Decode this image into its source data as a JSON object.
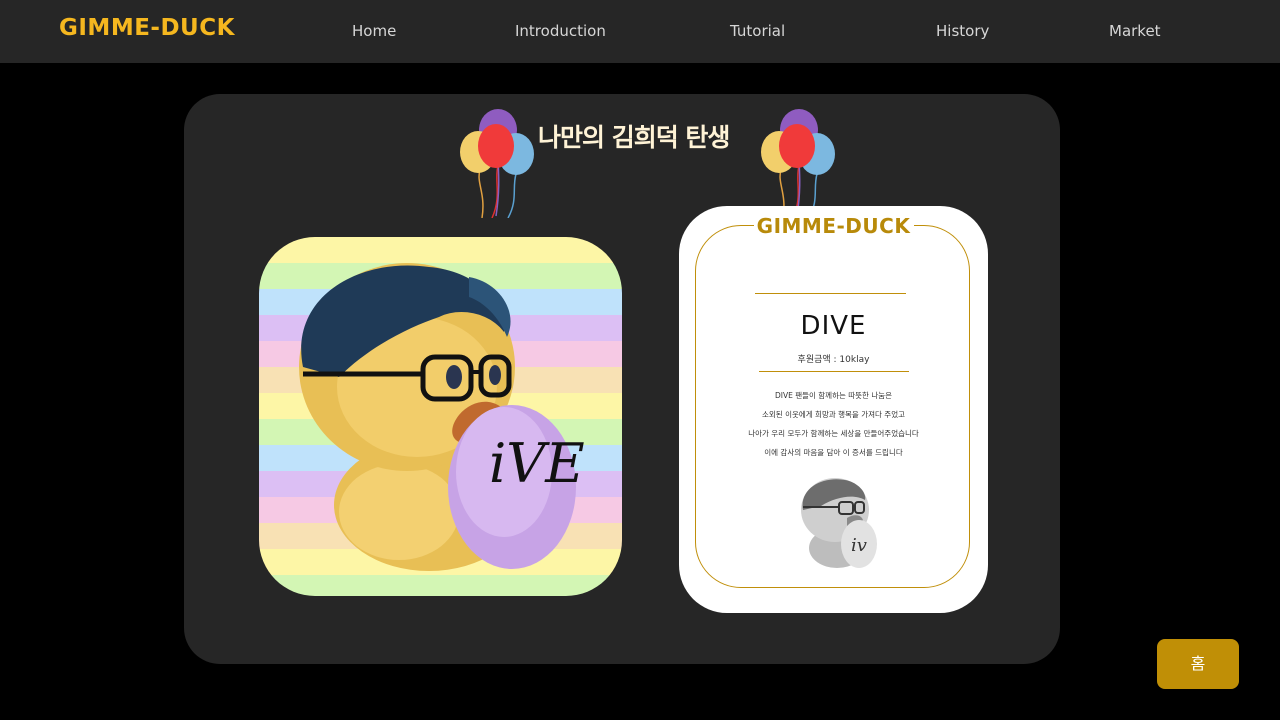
{
  "brand": "GIMME-DUCK",
  "nav": {
    "items": [
      {
        "label": "Home"
      },
      {
        "label": "Introduction"
      },
      {
        "label": "Tutorial"
      },
      {
        "label": "History"
      },
      {
        "label": "Market"
      }
    ]
  },
  "headline": "나만의 김희덕 탄생",
  "certificate": {
    "title": "GIMME-DUCK",
    "name": "DIVE",
    "amount": "후원금액 : 10klay",
    "lines": [
      "DIVE 팬들이 함께하는 따뜻한 나눔은",
      "소외된 이웃에게 희망과 행복을 가져다 주었고",
      "나아가 우리 모두가 함께하는 세상을 만들어주었습니다",
      "이에 감사의 마음을 담아 이 증서를 드립니다"
    ]
  },
  "art": {
    "egg_text": "iVE"
  },
  "home_button": {
    "label": "홈"
  },
  "colors": {
    "accent": "#f5b71f",
    "gold": "#c08f06",
    "panel": "#262626"
  }
}
